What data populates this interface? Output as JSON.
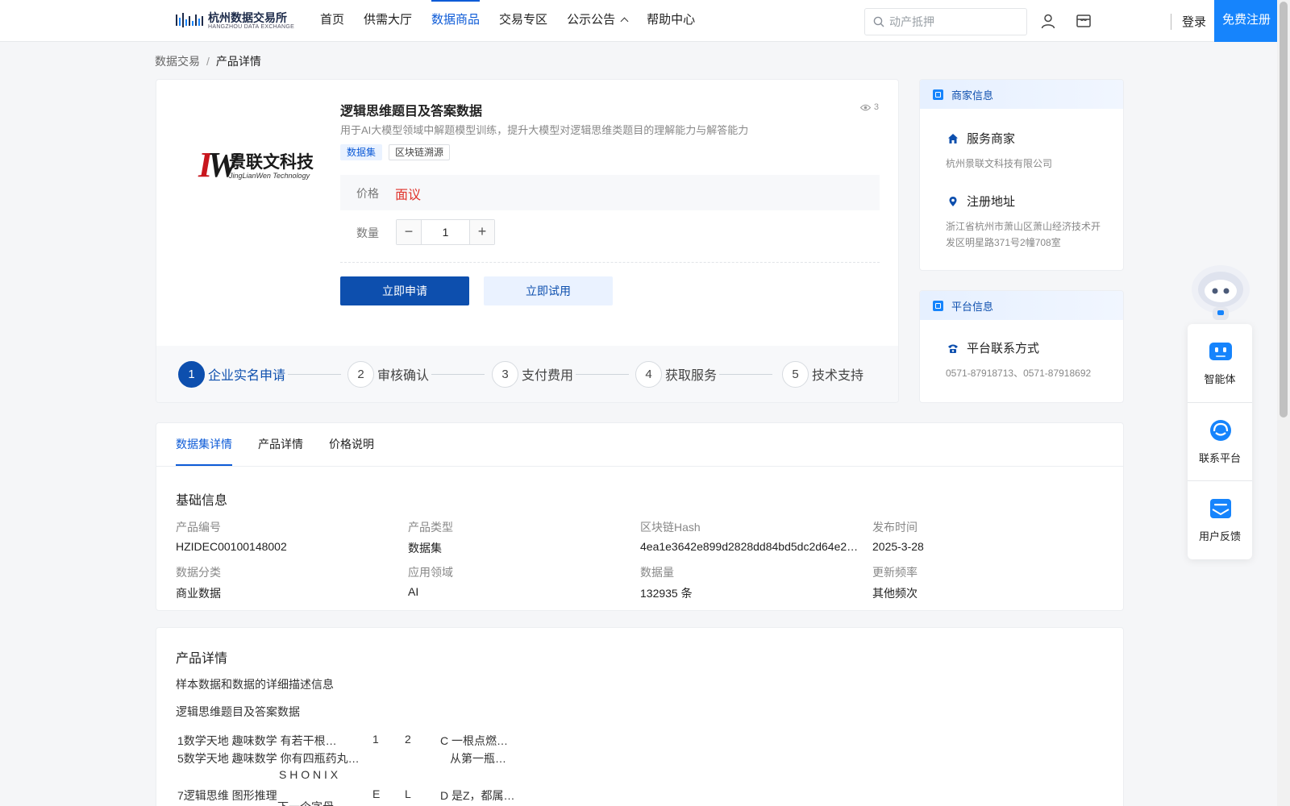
{
  "header": {
    "logo_cn": "杭州数据交易所",
    "logo_en": "HANGZHOU DATA EXCHANGE",
    "nav": [
      {
        "label": "首页"
      },
      {
        "label": "供需大厅"
      },
      {
        "label": "数据商品"
      },
      {
        "label": "交易专区"
      },
      {
        "label": "公示公告"
      },
      {
        "label": "帮助中心"
      }
    ],
    "search_placeholder": "动产抵押",
    "login": "登录",
    "register": "免费注册"
  },
  "breadcrumb": {
    "parent": "数据交易",
    "separator": "/",
    "current": "产品详情"
  },
  "product": {
    "logo_cn": "景联文科技",
    "logo_en": "JingLianWen Technology",
    "title": "逻辑思维题目及答案数据",
    "views": "3",
    "description": "用于AI大模型领域中解题模型训练，提升大模型对逻辑思维类题目的理解能力与解答能力",
    "tags": [
      "数据集",
      "区块链溯源"
    ],
    "price_label": "价格",
    "price_value": "面议",
    "qty_label": "数量",
    "qty_value": "1",
    "qty_minus": "−",
    "qty_plus": "+",
    "apply_label": "立即申请",
    "trial_label": "立即试用",
    "steps": [
      {
        "num": "1",
        "label": "企业实名申请"
      },
      {
        "num": "2",
        "label": "审核确认"
      },
      {
        "num": "3",
        "label": "支付费用"
      },
      {
        "num": "4",
        "label": "获取服务"
      },
      {
        "num": "5",
        "label": "技术支持"
      }
    ]
  },
  "merchant": {
    "title": "商家信息",
    "service_label": "服务商家",
    "service_value": "杭州景联文科技有限公司",
    "address_label": "注册地址",
    "address_value": "浙江省杭州市萧山区萧山经济技术开发区明星路371号2幢708室"
  },
  "platform": {
    "title": "平台信息",
    "contact_label": "平台联系方式",
    "contact_value": "0571-87918713、0571-87918692"
  },
  "floating": {
    "items": [
      {
        "label": "智能体"
      },
      {
        "label": "联系平台"
      },
      {
        "label": "用户反馈"
      }
    ]
  },
  "tabs": [
    {
      "label": "数据集详情"
    },
    {
      "label": "产品详情"
    },
    {
      "label": "价格说明"
    }
  ],
  "basic_info": {
    "title": "基础信息",
    "fields": [
      {
        "label": "产品编号",
        "value": "HZIDEC00100148002"
      },
      {
        "label": "产品类型",
        "value": "数据集"
      },
      {
        "label": "区块链Hash",
        "value": "4ea1e3642e899d2828dd84bd5dc2d64e2…"
      },
      {
        "label": "发布时间",
        "value": "2025-3-28"
      },
      {
        "label": "数据分类",
        "value": "商业数据"
      },
      {
        "label": "应用领域",
        "value": "AI"
      },
      {
        "label": "数据量",
        "value": "132935 条"
      },
      {
        "label": "更新频率",
        "value": "其他频次"
      }
    ]
  },
  "detail": {
    "title": "产品详情",
    "line1": "样本数据和数据的详细描述信息",
    "line2": "逻辑思维题目及答案数据",
    "sample_rows": [
      {
        "c1": "1数学天地 趣味数学 有若干根…",
        "c2": "1",
        "c3": "2",
        "c4": "C 一根点燃…"
      },
      {
        "c1": "5数学天地 趣味数学 你有四瓶药丸…",
        "c2": "",
        "c3": "",
        "c4": "从第一瓶…"
      },
      {
        "c1": "S H O N I X",
        "c2": "",
        "c3": "",
        "c4": ""
      },
      {
        "c1": "7逻辑思维 图形推理",
        "c2": "E",
        "c3": "L",
        "c4": "D 是Z，都属…"
      },
      {
        "c1": "下一个字母…",
        "c2": "",
        "c3": "",
        "c4": ""
      }
    ]
  },
  "colors": {
    "primary": "#0d4fae",
    "accent": "#1684fc",
    "price": "#e0312a"
  }
}
